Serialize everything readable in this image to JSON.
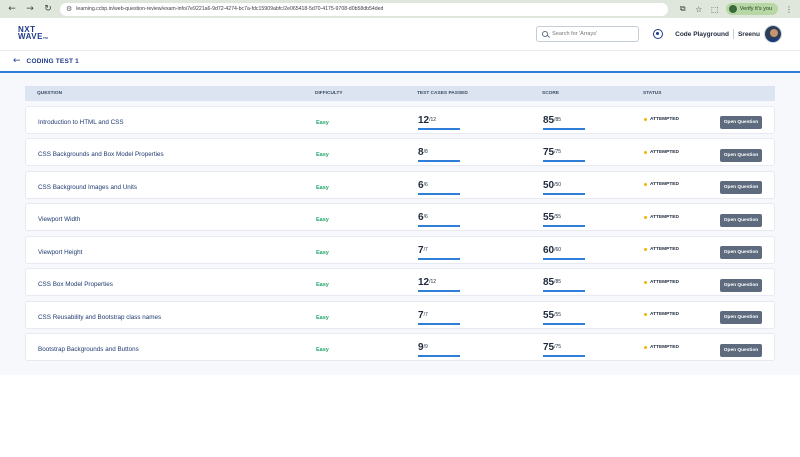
{
  "browser": {
    "url": "learning.ccbp.in/web-question-review/exam-info/7e9221a6-9d72-4274-bc7a-fdc15909abfc/2e065418-5d70-4175-9708-d0b58db54ded",
    "verify_label": "Verify it's you"
  },
  "header": {
    "logo_top": "NXT",
    "logo_bottom": "WAVE",
    "logo_tm": "TM",
    "search_placeholder": "Search for 'Arrays'",
    "code_playground": "Code Playground",
    "username": "Sreenu"
  },
  "subheader": {
    "title": "CODING TEST 1"
  },
  "table": {
    "columns": {
      "question": "QUESTION",
      "difficulty": "DIFFICULTY",
      "tests": "TEST CASES PASSED",
      "score": "SCORE",
      "status": "STATUS"
    },
    "rows": [
      {
        "title": "Introduction to HTML and CSS",
        "difficulty": "Easy",
        "passed": "12",
        "passed_total": "/12",
        "score": "85",
        "score_total": "/85",
        "status": "ATTEMPTED",
        "action": "Open Question"
      },
      {
        "title": "CSS Backgrounds and Box Model Properties",
        "difficulty": "Easy",
        "passed": "8",
        "passed_total": "/8",
        "score": "75",
        "score_total": "/75",
        "status": "ATTEMPTED",
        "action": "Open Question"
      },
      {
        "title": "CSS Background Images and Units",
        "difficulty": "Easy",
        "passed": "6",
        "passed_total": "/6",
        "score": "50",
        "score_total": "/50",
        "status": "ATTEMPTED",
        "action": "Open Question"
      },
      {
        "title": "Viewport Width",
        "difficulty": "Easy",
        "passed": "6",
        "passed_total": "/6",
        "score": "55",
        "score_total": "/55",
        "status": "ATTEMPTED",
        "action": "Open Question"
      },
      {
        "title": "Viewport Height",
        "difficulty": "Easy",
        "passed": "7",
        "passed_total": "/7",
        "score": "60",
        "score_total": "/60",
        "status": "ATTEMPTED",
        "action": "Open Question"
      },
      {
        "title": "CSS Box Model Properties",
        "difficulty": "Easy",
        "passed": "12",
        "passed_total": "/12",
        "score": "85",
        "score_total": "/85",
        "status": "ATTEMPTED",
        "action": "Open Question"
      },
      {
        "title": "CSS Reusability and Bootstrap class names",
        "difficulty": "Easy",
        "passed": "7",
        "passed_total": "/7",
        "score": "55",
        "score_total": "/55",
        "status": "ATTEMPTED",
        "action": "Open Question"
      },
      {
        "title": "Bootstrap Backgrounds and Buttons",
        "difficulty": "Easy",
        "passed": "9",
        "passed_total": "/9",
        "score": "75",
        "score_total": "/75",
        "status": "ATTEMPTED",
        "action": "Open Question"
      }
    ]
  },
  "colors": {
    "accent": "#2f7fd9",
    "brand": "#1e3a8a",
    "easy": "#22a66b",
    "attempted": "#f2b705",
    "button": "#5e6a7e"
  },
  "icons": {
    "back": "back-arrow-icon",
    "search": "search-icon",
    "streak": "streak-icon"
  }
}
